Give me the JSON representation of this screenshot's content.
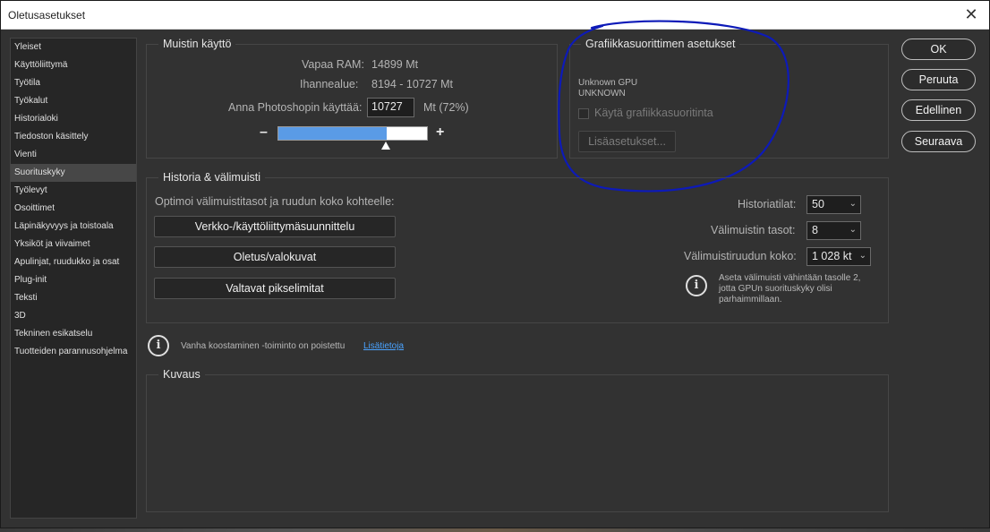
{
  "window": {
    "title": "Oletusasetukset",
    "close_glyph": "✕"
  },
  "sidebar": {
    "items": [
      {
        "label": "Yleiset"
      },
      {
        "label": "Käyttöliittymä"
      },
      {
        "label": "Työtila"
      },
      {
        "label": "Työkalut"
      },
      {
        "label": "Historialoki"
      },
      {
        "label": "Tiedoston käsittely"
      },
      {
        "label": "Vienti"
      },
      {
        "label": "Suorituskyky",
        "active": true
      },
      {
        "label": "Työlevyt"
      },
      {
        "label": "Osoittimet"
      },
      {
        "label": "Läpinäkyvyys ja toistoala"
      },
      {
        "label": "Yksiköt ja viivaimet"
      },
      {
        "label": "Apulinjat, ruudukko ja osat"
      },
      {
        "label": "Plug-init"
      },
      {
        "label": "Teksti"
      },
      {
        "label": "3D"
      },
      {
        "label": "Tekninen esikatselu"
      },
      {
        "label": "Tuotteiden parannusohjelma"
      }
    ]
  },
  "memory": {
    "title": "Muistin käyttö",
    "free_ram_label": "Vapaa RAM:",
    "free_ram_value": "14899 Mt",
    "ideal_label": "Ihannealue:",
    "ideal_value": "8194 - 10727 Mt",
    "allow_label": "Anna Photoshopin käyttää:",
    "allow_value": "10727",
    "allow_unit": "Mt (72%)",
    "slider_fraction": 0.72,
    "minus": "–",
    "plus": "+"
  },
  "gpu": {
    "title": "Grafiikkasuorittimen asetukset",
    "gpu_name": "Unknown GPU",
    "gpu_vendor": "UNKNOWN",
    "use_gpu_label": "Käytä grafiikkasuoritinta",
    "advanced_button": "Lisäasetukset..."
  },
  "history": {
    "title": "Historia & välimuisti",
    "optimize_label": "Optimoi välimuistitasot ja ruudun koko kohteelle:",
    "preset_buttons": [
      "Verkko-/käyttöliittymäsuunnittelu",
      "Oletus/valokuvat",
      "Valtavat pikselimitat"
    ],
    "history_states_label": "Historiatilat:",
    "history_states_value": "50",
    "cache_levels_label": "Välimuistin tasot:",
    "cache_levels_value": "8",
    "tile_size_label": "Välimuistiruudun koko:",
    "tile_size_value": "1 028 kt",
    "info_text_1": "Aseta välimuisti vähintään tasolle 2,",
    "info_text_2": "jotta GPUn suorituskyky olisi",
    "info_text_3": "parhaimmillaan."
  },
  "notice": {
    "text": "Vanha koostaminen -toiminto on poistettu",
    "link": "Lisätietoja"
  },
  "description": {
    "title": "Kuvaus"
  },
  "buttons": {
    "ok": "OK",
    "cancel": "Peruuta",
    "prev": "Edellinen",
    "next": "Seuraava"
  },
  "icons": {
    "info": "i",
    "chevron": "⌄"
  },
  "colors": {
    "slider_fill": "#5a9be6",
    "link": "#4aa3ff",
    "annotation": "#0d1ab8"
  }
}
